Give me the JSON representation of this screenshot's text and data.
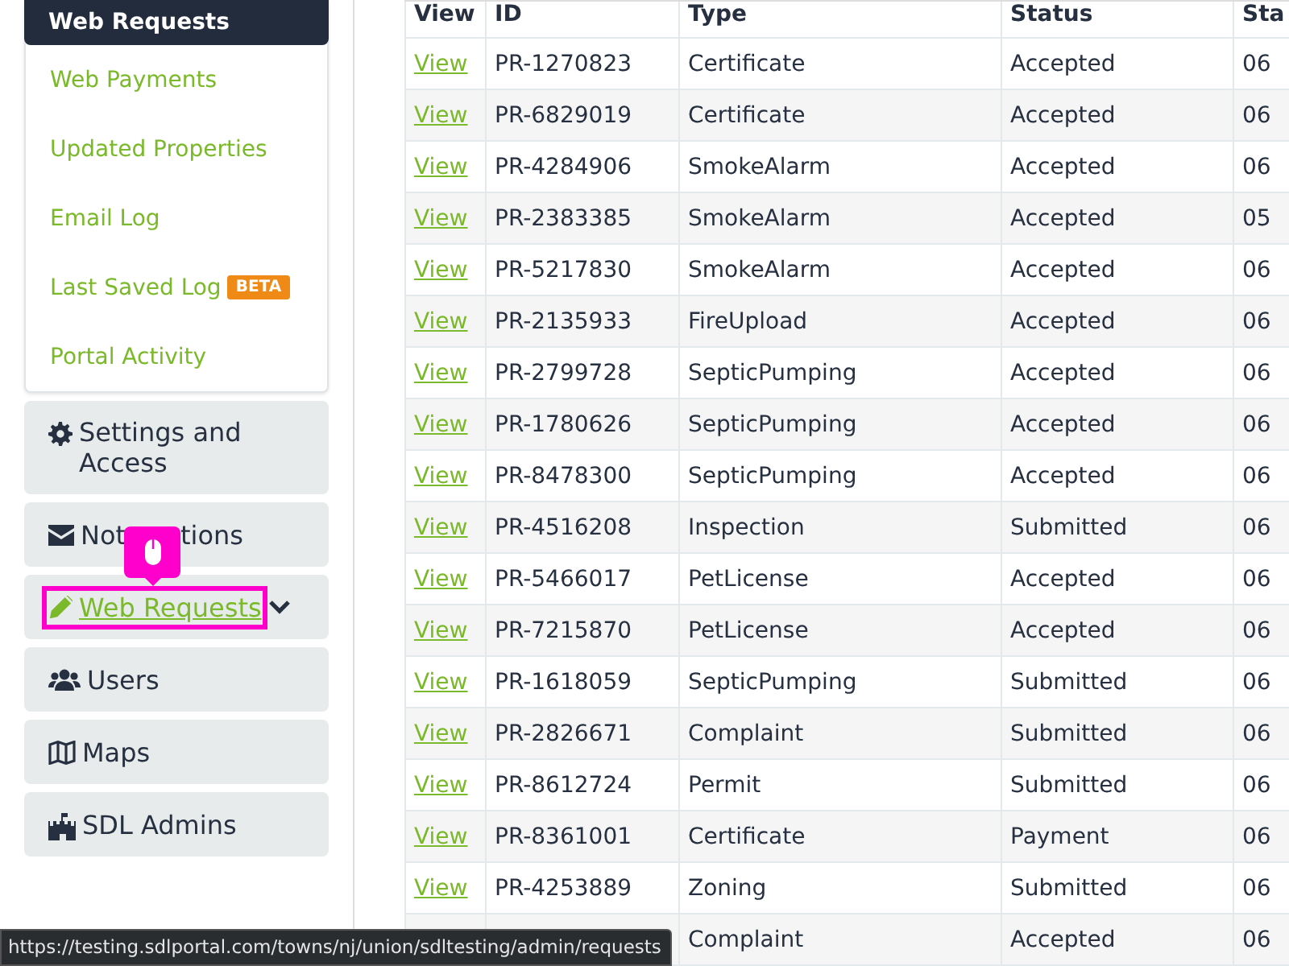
{
  "sidebar": {
    "submenu": {
      "title": "Web Requests",
      "items": [
        {
          "label": "Web Payments"
        },
        {
          "label": "Updated Properties"
        },
        {
          "label": "Email Log"
        },
        {
          "label": "Last Saved Log",
          "badge": "BETA"
        },
        {
          "label": "Portal Activity"
        }
      ]
    },
    "items": [
      {
        "label": "Settings and Access",
        "kind": "plain"
      },
      {
        "label_parts": [
          "Not",
          "tions"
        ],
        "kind": "covered"
      },
      {
        "label": "Web Requests",
        "kind": "link",
        "expanded": false
      },
      {
        "label": "Users",
        "kind": "plain"
      },
      {
        "label": "Maps",
        "kind": "plain"
      },
      {
        "label": "SDL Admins",
        "kind": "plain"
      }
    ]
  },
  "table": {
    "columns": [
      "View",
      "ID",
      "Type",
      "Status",
      "Sta"
    ],
    "rows": [
      [
        "View",
        "PR-1270823",
        "Certificate",
        "Accepted",
        "06"
      ],
      [
        "View",
        "PR-6829019",
        "Certificate",
        "Accepted",
        "06"
      ],
      [
        "View",
        "PR-4284906",
        "SmokeAlarm",
        "Accepted",
        "06"
      ],
      [
        "View",
        "PR-2383385",
        "SmokeAlarm",
        "Accepted",
        "05"
      ],
      [
        "View",
        "PR-5217830",
        "SmokeAlarm",
        "Accepted",
        "06"
      ],
      [
        "View",
        "PR-2135933",
        "FireUpload",
        "Accepted",
        "06"
      ],
      [
        "View",
        "PR-2799728",
        "SepticPumping",
        "Accepted",
        "06"
      ],
      [
        "View",
        "PR-1780626",
        "SepticPumping",
        "Accepted",
        "06"
      ],
      [
        "View",
        "PR-8478300",
        "SepticPumping",
        "Accepted",
        "06"
      ],
      [
        "View",
        "PR-4516208",
        "Inspection",
        "Submitted",
        "06"
      ],
      [
        "View",
        "PR-5466017",
        "PetLicense",
        "Accepted",
        "06"
      ],
      [
        "View",
        "PR-7215870",
        "PetLicense",
        "Accepted",
        "06"
      ],
      [
        "View",
        "PR-1618059",
        "SepticPumping",
        "Submitted",
        "06"
      ],
      [
        "View",
        "PR-2826671",
        "Complaint",
        "Submitted",
        "06"
      ],
      [
        "View",
        "PR-8612724",
        "Permit",
        "Submitted",
        "06"
      ],
      [
        "View",
        "PR-8361001",
        "Certificate",
        "Payment",
        "06"
      ],
      [
        "View",
        "PR-4253889",
        "Zoning",
        "Submitted",
        "06"
      ],
      [
        null,
        null,
        "Complaint",
        "Accepted",
        "06"
      ]
    ]
  },
  "status_bar": {
    "url": "https://testing.sdlportal.com/towns/nj/union/sdltesting/admin/requests"
  }
}
